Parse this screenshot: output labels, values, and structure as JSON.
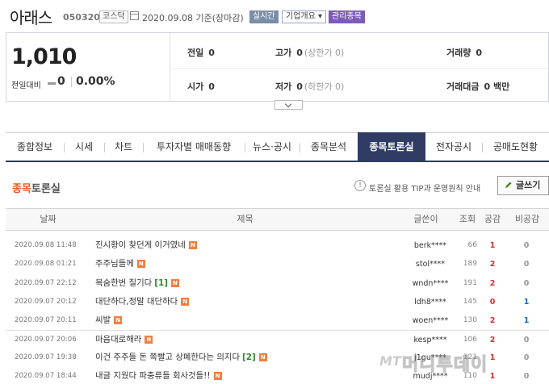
{
  "header": {
    "company_name": "아래스",
    "stock_code": "050320",
    "market": "코스닥",
    "date_text": "2020.09.08 기준(장마감)",
    "realtime_label": "실시간",
    "company_info_label": "기업개요 ▾",
    "watchlist_label": "관리종목"
  },
  "summary": {
    "current_price": "1,010",
    "change_label": "전일대비",
    "change_value": "0",
    "change_pct": "0.00%",
    "prev_close_label": "전일",
    "prev_close": "0",
    "high_label": "고가",
    "high": "0",
    "upper_limit": "(상한가 0)",
    "volume_label": "거래량",
    "volume": "0",
    "open_label": "시가",
    "open": "0",
    "low_label": "저가",
    "low": "0",
    "lower_limit": "(하한가 0)",
    "amount_label": "거래대금",
    "amount": "0 백만"
  },
  "tabs": [
    {
      "label": "종합정보"
    },
    {
      "label": "시세"
    },
    {
      "label": "차트"
    },
    {
      "label": "투자자별 매매동향"
    },
    {
      "label": "뉴스·공시"
    },
    {
      "label": "종목분석"
    },
    {
      "label": "종목토론실",
      "active": true
    },
    {
      "label": "전자공시"
    },
    {
      "label": "공매도현황"
    }
  ],
  "board": {
    "title_accent": "종목",
    "title_rest": "토론실",
    "tip_icon_glyph": "!",
    "tip_text": "토론실 활용 TIP과 운영원칙 안내",
    "write_label": "글쓰기",
    "new_badge": "N",
    "columns": {
      "date": "날짜",
      "title": "제목",
      "author": "글쓴이",
      "views": "조회",
      "likes": "공감",
      "dislikes": "비공감"
    },
    "rows": [
      {
        "date": "2020.09.08 11:48",
        "title": "진시황이 찾던게 이거였네",
        "comments": "",
        "author": "berk****",
        "views": "66",
        "likes": "1",
        "dislikes": "0"
      },
      {
        "date": "2020.09.08 01:21",
        "title": "주주님들께",
        "comments": "",
        "author": "stol****",
        "views": "189",
        "likes": "2",
        "dislikes": "0"
      },
      {
        "date": "2020.09.07 22:12",
        "title": "목숨한번 질기다",
        "comments": "[1]",
        "author": "wndn****",
        "views": "191",
        "likes": "2",
        "dislikes": "0"
      },
      {
        "date": "2020.09.07 20:12",
        "title": "대단하다,정말 대단하다",
        "comments": "",
        "author": "ldh8****",
        "views": "145",
        "likes": "0",
        "dislikes": "1"
      },
      {
        "date": "2020.09.07 20:11",
        "title": "씨발",
        "comments": "",
        "author": "woen****",
        "views": "130",
        "likes": "2",
        "dislikes": "1"
      },
      {
        "date": "2020.09.07 20:06",
        "title": "마음대로해라",
        "comments": "",
        "author": "kesp****",
        "views": "106",
        "likes": "2",
        "dislikes": "0"
      },
      {
        "date": "2020.09.07 19:38",
        "title": "이건 주주들 돈 쪽빨고 상폐한다는 의지다",
        "comments": "[2]",
        "author": "j1gu****",
        "views": "121",
        "likes": "1",
        "dislikes": "0"
      },
      {
        "date": "2020.09.07 18:44",
        "title": "내글 지웠다 파충류들 회사것들!!",
        "comments": "",
        "author": "mudj****",
        "views": "110",
        "likes": "1",
        "dislikes": "0"
      }
    ]
  },
  "watermark": {
    "logo": "MT",
    "text": "머니투데이"
  }
}
